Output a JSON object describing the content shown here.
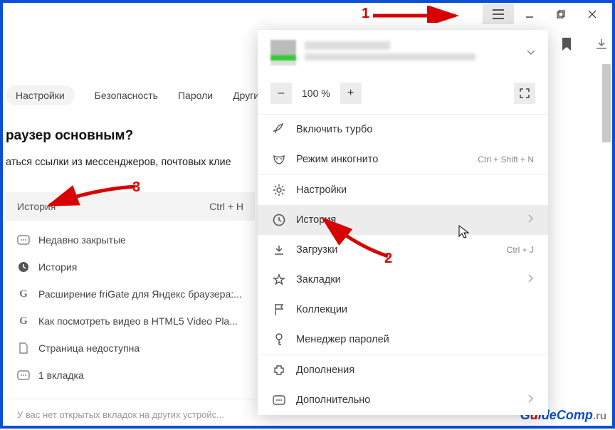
{
  "window": {
    "controls": {
      "min": "—",
      "max": "❐",
      "close": "✕",
      "menu": "≡"
    }
  },
  "toolbar": {
    "bookmark_icon": "bookmark",
    "download_icon": "download"
  },
  "tabs": {
    "settings": "Настройки",
    "security": "Безопасность",
    "passwords": "Пароли",
    "other": "Другие у"
  },
  "page": {
    "heading": "раузер основным?",
    "subtext": "аться ссылки из мессенджеров, почтовых клие"
  },
  "history_panel": {
    "title": "История",
    "shortcut": "Ctrl + H",
    "items": [
      {
        "icon": "recent",
        "label": "Недавно закрытые"
      },
      {
        "icon": "clock",
        "label": "История"
      },
      {
        "icon": "g",
        "label": "Расширение friGate для Яндекс браузера:..."
      },
      {
        "icon": "g",
        "label": "Как посмотреть видео в HTML5 Video Pla..."
      },
      {
        "icon": "page",
        "label": "Страница недоступна"
      },
      {
        "icon": "tab",
        "label": "1 вкладка"
      }
    ],
    "footer": "У вас нет открытых вкладок на других устройс..."
  },
  "menu": {
    "zoom": {
      "minus": "–",
      "value": "100 %",
      "plus": "+"
    },
    "turbo": "Включить турбо",
    "incognito": {
      "label": "Режим инкогнито",
      "shortcut": "Ctrl + Shift + N"
    },
    "settings": "Настройки",
    "history": "История",
    "downloads": {
      "label": "Загрузки",
      "shortcut": "Ctrl + J"
    },
    "bookmarks": "Закладки",
    "collections": "Коллекции",
    "passwords": "Менеджер паролей",
    "addons": "Дополнения",
    "more": "Дополнительно"
  },
  "annotations": {
    "one": "1",
    "two": "2",
    "three": "3"
  },
  "watermark": {
    "text": "GuideComp",
    "suffix": ".ru"
  }
}
